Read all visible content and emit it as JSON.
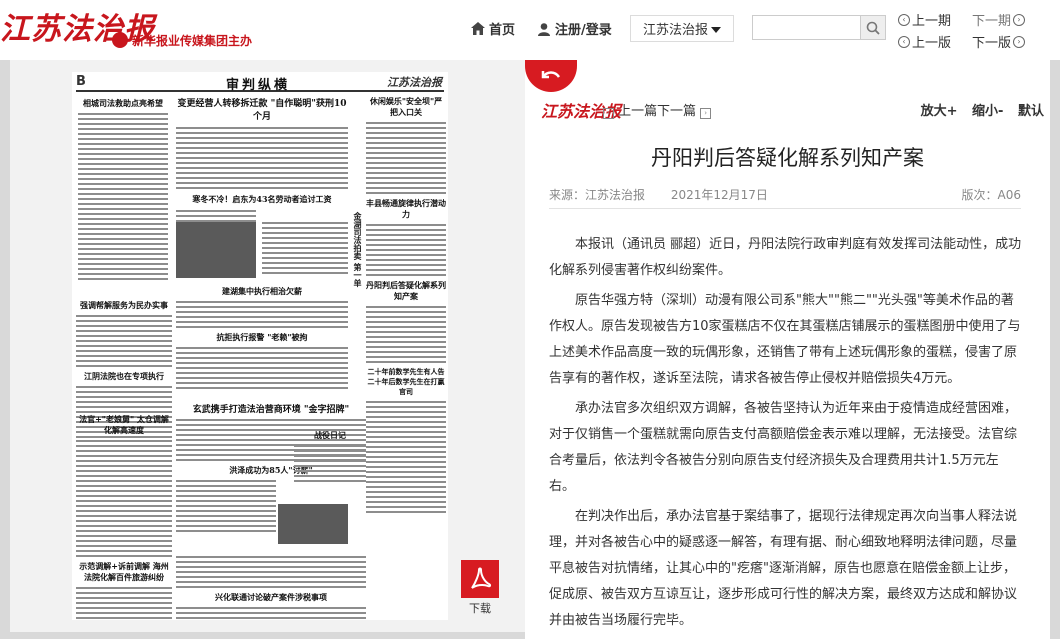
{
  "header": {
    "logo_text": "江苏法治报",
    "group_text": "新华报业传媒集团主办",
    "nav_home": "首页",
    "nav_login": "注册/登录",
    "paper_select": "江苏法治报",
    "search_placeholder": "",
    "prev_issue": "上一期",
    "next_issue": "下一期",
    "prev_page": "上一版",
    "next_page": "下一版"
  },
  "newspaper": {
    "page_no": "B",
    "section": "审判纵横",
    "brand": "江苏法治报",
    "headlines": {
      "main": "变更经营人转移拆迁款 \"自作聪明\"获刑10个月",
      "sub1": "寒冬不冷！启东为43名劳动者追讨工资",
      "left1": "相城司法救助点亮希望",
      "left2": "强调帮解服务为民办实事",
      "left3": "江阴法院也在专项执行",
      "left4": "法官+\"老娘舅\" 太仓调解化解高速度",
      "mid1": "建湖集中执行相治欠薪",
      "mid2": "抗拒执行报警 \"老赖\"被拘",
      "bottom_main": "玄武携手打造法治营商环境 \"金字招牌\"",
      "right1": "休闲娱乐\"安全坝\"严把入口关",
      "right2": "丰县畅通旋律执行潜动力",
      "right3": "丹阳判后答疑化解系列知产案",
      "right4": "二十年前数学先生有人告 二十年后数学先生在打赢官司",
      "bottom1": "洪泽成功为85人\"讨薪\"",
      "bottom2": "战役日记",
      "bottom3": "示范调解+诉前调解 海州法院化解百件旅游纠纷",
      "bottom4": "兴化联通讨论破产案件涉税事项"
    },
    "vertical_slogan": "金湖司法拍卖 第一单"
  },
  "download": {
    "label": "下载"
  },
  "article": {
    "logo": "江苏法治报",
    "prev_article": "上一篇",
    "next_article": "下一篇",
    "zoom_in": "放大+",
    "zoom_out": "缩小-",
    "reset": "默认",
    "title": "丹阳判后答疑化解系列知产案",
    "source": "来源：江苏法治报",
    "date": "2021年12月17日",
    "edition": "版次：A06",
    "paragraphs": [
      "本报讯（通讯员 郦超）近日，丹阳法院行政审判庭有效发挥司法能动性，成功化解系列侵害著作权纠纷案件。",
      "原告华强方特（深圳）动漫有限公司系\"熊大\"\"熊二\"\"光头强\"等美术作品的著作权人。原告发现被告方10家蛋糕店不仅在其蛋糕店铺展示的蛋糕图册中使用了与上述美术作品高度一致的玩偶形象，还销售了带有上述玩偶形象的蛋糕，侵害了原告享有的著作权，遂诉至法院，请求各被告停止侵权并赔偿损失4万元。",
      "承办法官多次组织双方调解，各被告坚持认为近年来由于疫情造成经营困难，对于仅销售一个蛋糕就需向原告支付高额赔偿金表示难以理解，无法接受。法官综合考量后，依法判令各被告分别向原告支付经济损失及合理费用共计1.5万元左右。",
      "在判决作出后，承办法官基于案结事了，据现行法律规定再次向当事人释法说理，并对各被告心中的疑惑逐一解答，有理有据、耐心细致地释明法律问题，尽量平息被告对抗情绪，让其心中的\"疙瘩\"逐渐消解，原告也愿意在赔偿金额上让步，促成原、被告双方互谅互让，逐步形成可行性的解决方案，最终双方达成和解协议并由被告当场履行完毕。"
    ]
  },
  "icons": [
    "home-icon",
    "user-icon",
    "search-icon",
    "back-arrow-icon",
    "pdf-icon"
  ],
  "colors": {
    "brand_red": "#c8161d",
    "pdf_red": "#d71b21"
  }
}
